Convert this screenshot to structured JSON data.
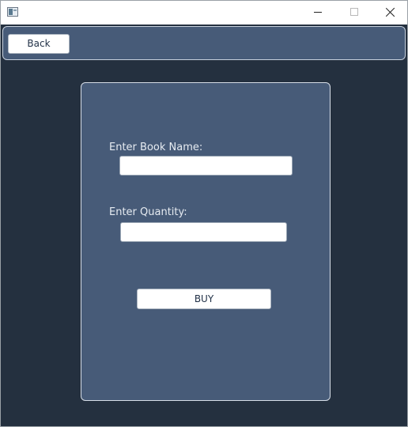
{
  "window": {
    "icon": "app-window-icon",
    "controls": {
      "minimize_icon": "minimize-icon",
      "maximize_icon": "maximize-icon",
      "close_icon": "close-icon"
    }
  },
  "toolbar": {
    "back_label": "Back"
  },
  "form": {
    "book_name_label": "Enter Book Name:",
    "book_name_value": "",
    "quantity_label": "Enter Quantity:",
    "quantity_value": "",
    "buy_label": "BUY"
  },
  "colors": {
    "background": "#24303f",
    "panel": "#475b78",
    "panel_border": "#d6dde7",
    "label_text": "#e6ebf1",
    "button_bg": "#ffffff"
  }
}
